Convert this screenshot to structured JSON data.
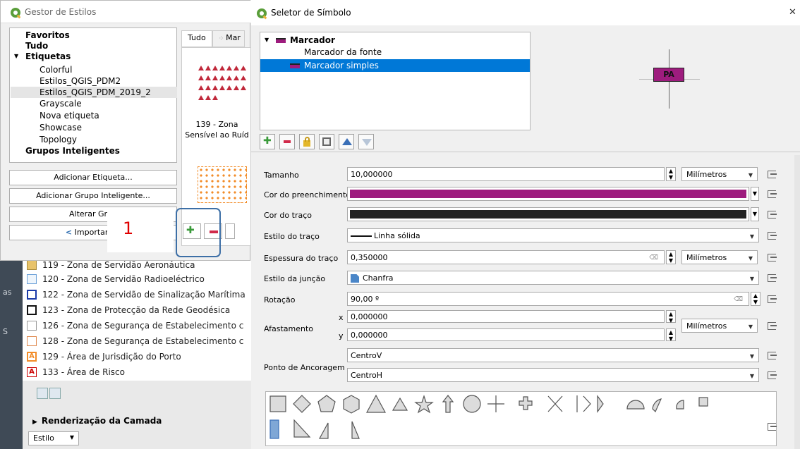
{
  "style_manager": {
    "title": "Gestor de Estilos",
    "tree": {
      "favorites": "Favoritos",
      "all": "Tudo",
      "tags": "Etiquetas",
      "tag_items": [
        "Colorful",
        "Estilos_QGIS_PDM2",
        "Estilos_QGIS_PDM_2019_2",
        "Grayscale",
        "Nova etiqueta",
        "Showcase",
        "Topology"
      ],
      "smart_groups": "Grupos Inteligentes"
    },
    "buttons": {
      "add_tag": "Adicionar Etiqueta...",
      "add_smart_group": "Adicionar Grupo Inteligente...",
      "change_group": "Alterar Grup",
      "import_export": "Importar / E"
    },
    "tabs": [
      "Tudo",
      "Mar"
    ],
    "preview_item": "139 - Zona Sensível ao Ruíd"
  },
  "annotation": {
    "number": "1"
  },
  "layers": {
    "items": [
      "119 - Zona de Servidão Aeronáutica",
      "120 - Zona de Servidão Radioeléctrico",
      "122 - Zona de Servidão de Sinalização Marítima",
      "123 - Zona de Protecção da Rede Geodésica",
      "126 - Zona de Segurança de Estabelecimento c",
      "128 - Zona de Segurança de Estabelecimento c",
      "129 - Área de Jurisdição do Porto",
      "133 - Área de Risco"
    ],
    "render_section": "Renderização da Camada",
    "style_combo": "Estilo",
    "dock_labels": [
      "as",
      "S"
    ]
  },
  "symbol_selector": {
    "title": "Seletor de Símbolo",
    "tree": {
      "root": "Marcador",
      "font_marker": "Marcador da fonte",
      "simple_marker": "Marcador simples"
    },
    "preview_label": "PA",
    "properties": {
      "size_label": "Tamanho",
      "size_value": "10,000000",
      "size_unit": "Milímetros",
      "fill_label": "Cor do preenchimento",
      "fill_color": "#9e1c7e",
      "stroke_color_label": "Cor do traço",
      "stroke_color": "#222222",
      "stroke_style_label": "Estilo do traço",
      "stroke_style_value": "Linha sólida",
      "stroke_width_label": "Espessura do traço",
      "stroke_width_value": "0,350000",
      "stroke_width_unit": "Milímetros",
      "join_label": "Estilo da junção",
      "join_value": "Chanfra",
      "rotation_label": "Rotação",
      "rotation_value": "90,00 º",
      "offset_label": "Afastamento",
      "offset_x_prefix": "x",
      "offset_x": "0,000000",
      "offset_y_prefix": "y",
      "offset_y": "0,000000",
      "offset_unit": "Milímetros",
      "anchor_label": "Ponto de Ancoragem",
      "anchor_v": "CentroV",
      "anchor_h": "CentroH"
    },
    "shape_icons": [
      "square-icon",
      "diamond-icon",
      "pentagon-icon",
      "hexagon-icon",
      "triangle-icon",
      "equilateral-triangle-icon",
      "star-icon",
      "arrow-icon",
      "circle-icon",
      "cross-icon",
      "cross-fill-icon",
      "x-icon",
      "line-icon",
      "arrowhead-icon",
      "filled-arrowhead-icon",
      "semicircle-icon",
      "third-circle-icon",
      "quarter-circle-icon",
      "quarter-square-icon",
      "half-square-icon",
      "diagonal-half-square-icon",
      "right-half-triangle-icon",
      "left-half-triangle-icon"
    ]
  },
  "colors": {
    "accent": "#0078d7",
    "annotation_red": "#e00000",
    "annotation_box": "#3d6fa6"
  }
}
